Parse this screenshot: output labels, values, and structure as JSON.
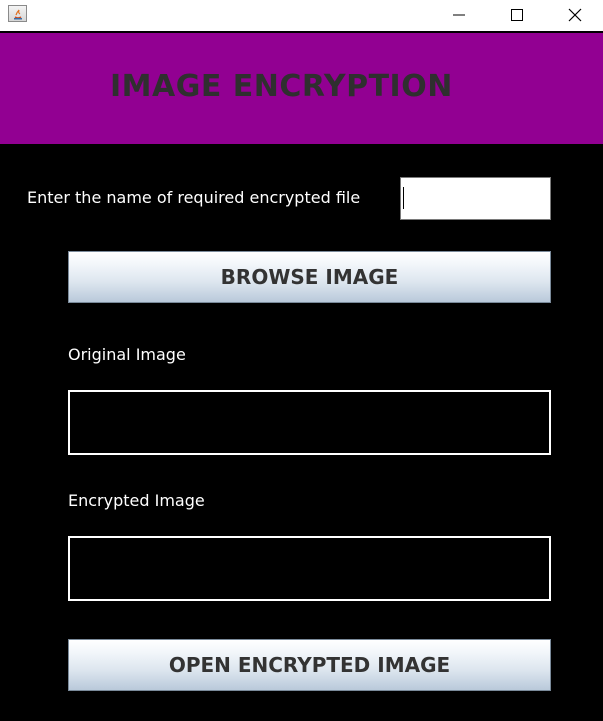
{
  "window": {
    "title": "",
    "controls": {
      "minimize_icon": "minimize-icon",
      "maximize_icon": "maximize-icon",
      "close_icon": "close-icon"
    }
  },
  "header": {
    "title": "IMAGE ENCRYPTION",
    "background": "#920092"
  },
  "form": {
    "filename_label": "Enter the name of required encrypted file",
    "filename_value": "",
    "browse_button": "BROWSE IMAGE",
    "original_label": "Original Image",
    "encrypted_label": "Encrypted Image",
    "open_button": "OPEN ENCRYPTED IMAGE"
  }
}
